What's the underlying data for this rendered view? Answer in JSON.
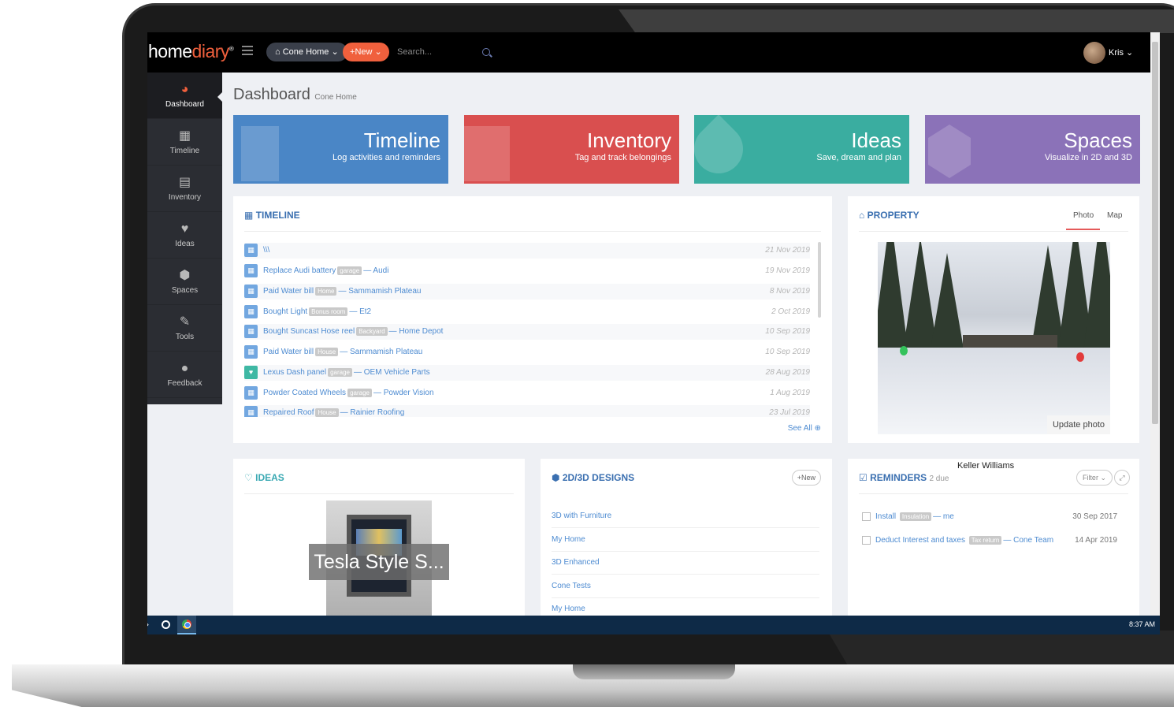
{
  "topbar": {
    "logo_home": "home",
    "logo_diary": "diary",
    "logo_mark": "®",
    "home_selector": "Cone Home",
    "new_button": "New",
    "search_placeholder": "Search...",
    "user_name": "Kris"
  },
  "sidebar": {
    "items": [
      {
        "label": "Dashboard",
        "icon": "dashboard-icon"
      },
      {
        "label": "Timeline",
        "icon": "calendar-icon"
      },
      {
        "label": "Inventory",
        "icon": "archive-icon"
      },
      {
        "label": "Ideas",
        "icon": "heart-icon"
      },
      {
        "label": "Spaces",
        "icon": "cube-icon"
      },
      {
        "label": "Tools",
        "icon": "wrench-icon"
      },
      {
        "label": "Feedback",
        "icon": "comment-icon"
      }
    ]
  },
  "page": {
    "title": "Dashboard",
    "subtitle": "Cone Home"
  },
  "tiles": [
    {
      "title": "Timeline",
      "subtitle": "Log activities and reminders",
      "color": "#4a86c6"
    },
    {
      "title": "Inventory",
      "subtitle": "Tag and track belongings",
      "color": "#d94f4f"
    },
    {
      "title": "Ideas",
      "subtitle": "Save, dream and plan",
      "color": "#3aada0"
    },
    {
      "title": "Spaces",
      "subtitle": "Visualize in 2D and 3D",
      "color": "#8b72b8"
    }
  ],
  "timeline": {
    "title": "TIMELINE",
    "see_all": "See All",
    "rows": [
      {
        "text": "\\\\\\",
        "tag": "",
        "suffix": "",
        "date": "21 Nov 2019"
      },
      {
        "text": "Replace Audi battery",
        "tag": "garage",
        "suffix": "— Audi",
        "date": "19 Nov 2019"
      },
      {
        "text": "Paid Water bill",
        "tag": "Home",
        "suffix": "— Sammamish Plateau",
        "date": "8 Nov 2019"
      },
      {
        "text": "Bought Light",
        "tag": "Bonus room",
        "suffix": "— Et2",
        "date": "2 Oct 2019"
      },
      {
        "text": "Bought Suncast Hose reel",
        "tag": "Backyard",
        "suffix": "— Home Depot",
        "date": "10 Sep 2019"
      },
      {
        "text": "Paid Water bill",
        "tag": "House",
        "suffix": "— Sammamish Plateau",
        "date": "10 Sep 2019"
      },
      {
        "text": "Lexus Dash panel",
        "tag": "garage",
        "suffix": "— OEM Vehicle Parts",
        "date": "28 Aug 2019"
      },
      {
        "text": "Powder Coated Wheels",
        "tag": "garage",
        "suffix": "— Powder Vision",
        "date": "1 Aug 2019"
      },
      {
        "text": "Repaired Roof",
        "tag": "House",
        "suffix": "— Rainier Roofing",
        "date": "23 Jul 2019"
      }
    ]
  },
  "property": {
    "title": "PROPERTY",
    "tab_photo": "Photo",
    "tab_map": "Map",
    "update_photo": "Update photo"
  },
  "ideas": {
    "title": "IDEAS",
    "caption": "Tesla Style S..."
  },
  "designs": {
    "title": "2D/3D DESIGNS",
    "new_button": "New",
    "rows": [
      "3D with Furniture",
      "My Home",
      "3D Enhanced",
      "Cone Tests",
      "My Home"
    ]
  },
  "reminders": {
    "title": "REMINDERS",
    "count": "2 due",
    "filter": "Filter",
    "overlay_text": "Keller Williams",
    "rows": [
      {
        "text": "Install",
        "tag": "Insulation",
        "suffix": "— me",
        "date": "30 Sep 2017"
      },
      {
        "text": "Deduct Interest and taxes",
        "tag": "Tax return",
        "suffix": "— Cone Team",
        "date": "14 Apr 2019"
      }
    ]
  },
  "taskbar": {
    "clock": "8:37 AM"
  }
}
